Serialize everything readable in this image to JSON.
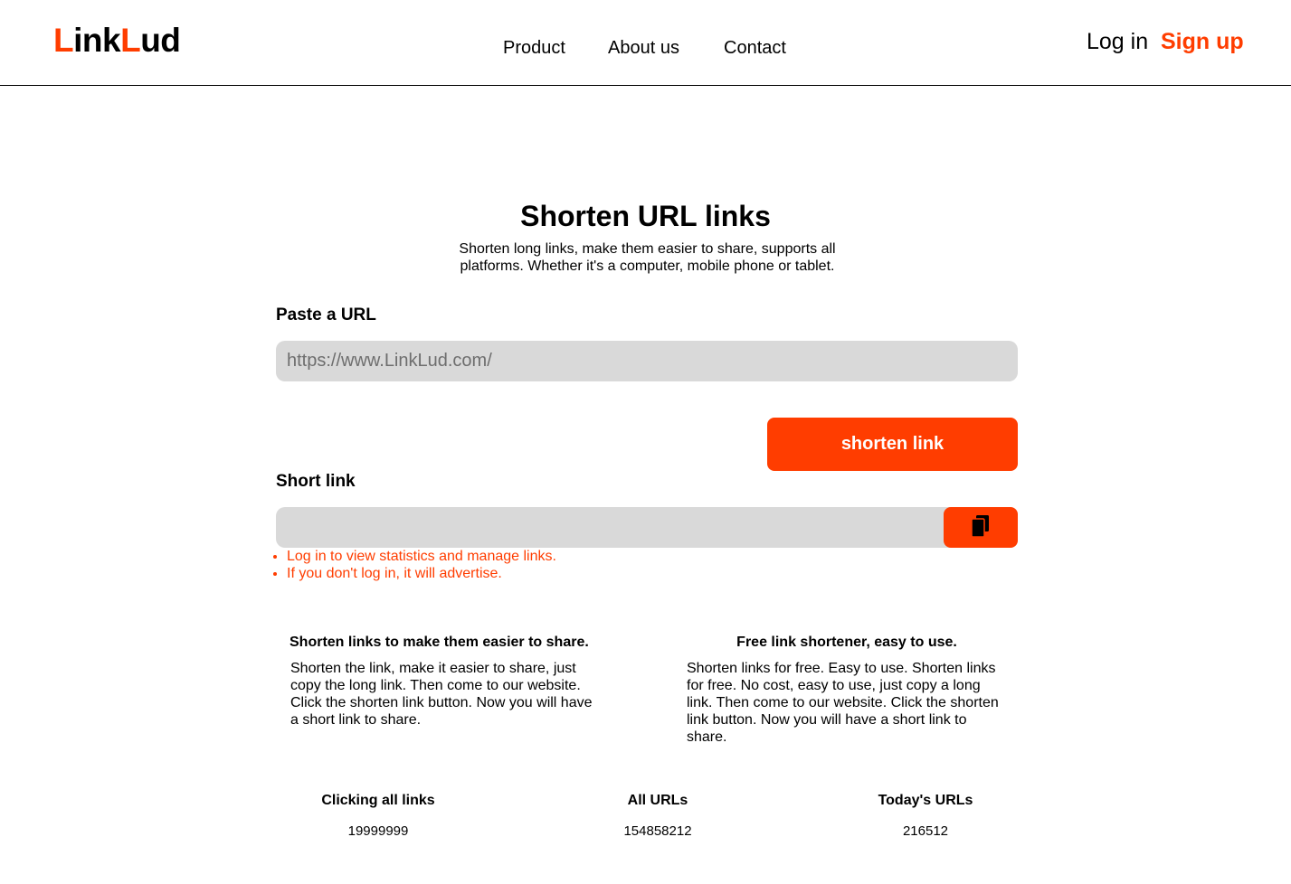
{
  "header": {
    "logo": {
      "part1": "L",
      "part2": "ink",
      "part3": "L",
      "part4": "ud"
    },
    "nav": [
      "Product",
      "About us",
      "Contact"
    ],
    "login": "Log in",
    "signup": "Sign up"
  },
  "hero": {
    "title": "Shorten URL links",
    "subtitle": "Shorten long links, make them easier to share, supports all platforms. Whether it's a computer, mobile phone or tablet."
  },
  "form": {
    "paste_label": "Paste a URL",
    "url_placeholder": "https://www.LinkLud.com/",
    "shorten_button": "shorten link",
    "short_label": "Short link",
    "short_value": "",
    "copy_icon": "copy-icon",
    "notes": [
      "Log in to view statistics and manage links.",
      "If you don't log in, it will advertise."
    ]
  },
  "features": [
    {
      "title": "Shorten links to make them easier to share.",
      "body": "Shorten the link, make it easier to share, just copy the long link. Then come to our website. Click the shorten link button. Now you will have a short link to share."
    },
    {
      "title": "Free link shortener, easy to use.",
      "body": "Shorten links for free. Easy to use. Shorten links for free. No cost, easy to use, just copy a long link. Then come to our website. Click the shorten link button. Now you will have a short link to share."
    }
  ],
  "stats": [
    {
      "label": "Clicking all links",
      "value": "19999999"
    },
    {
      "label": "All URLs",
      "value": "154858212"
    },
    {
      "label": "Today's URLs",
      "value": "216512"
    }
  ],
  "colors": {
    "accent": "#ff3d00",
    "input_bg": "#d9d9d9"
  }
}
